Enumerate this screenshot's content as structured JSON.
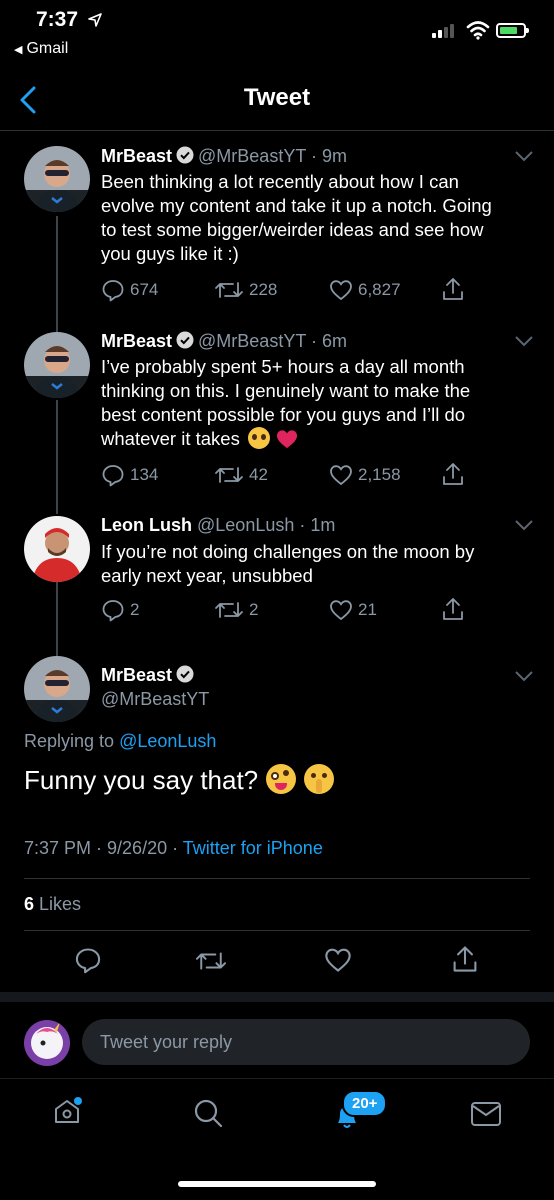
{
  "status_bar": {
    "time": "7:37",
    "back_app": "Gmail"
  },
  "header": {
    "title": "Tweet"
  },
  "tweets": [
    {
      "name": "MrBeast",
      "meta": "@MrBeastYT · 9m",
      "lines": [
        "Been thinking a lot recently about how I can",
        "evolve my content and take it up a notch. Going",
        "to test some bigger/weirder ideas and see how",
        "you guys like it :)"
      ],
      "replies": "674",
      "retweets": "228",
      "likes": "6,827"
    },
    {
      "name": "MrBeast",
      "meta": "@MrBeastYT · 6m",
      "lines": [
        "I’ve probably spent 5+ hours a day all month",
        "thinking on this. I genuinely want to make the",
        "best content possible for you guys and I’ll do",
        "whatever it takes"
      ],
      "replies": "134",
      "retweets": "42",
      "likes": "2,158"
    },
    {
      "name": "Leon Lush",
      "meta": "@LeonLush · 1m",
      "lines": [
        "If you’re not doing challenges on the moon by",
        "early next year, unsubbed"
      ],
      "replies": "2",
      "retweets": "2",
      "likes": "21"
    }
  ],
  "focused": {
    "name": "MrBeast",
    "handle": "@MrBeastYT",
    "replying_prefix": "Replying to ",
    "replying_to": "@LeonLush",
    "text": "Funny you say that?",
    "time": "7:37 PM · 9/26/20 · ",
    "source": "Twitter for iPhone",
    "likes_count": "6",
    "likes_label": "Likes"
  },
  "reply": {
    "placeholder": "Tweet your reply"
  },
  "tab_bar": {
    "notifications_badge": "20+"
  },
  "colors": {
    "accent": "#1da1f2",
    "background": "#000000",
    "muted": "#8b98a5",
    "like_heart": "#e0245e"
  },
  "icons": [
    "location-arrow-icon",
    "back-chevron-icon",
    "verified-icon",
    "caret-down-icon",
    "reply-icon",
    "retweet-icon",
    "like-icon",
    "share-icon",
    "home-icon",
    "search-icon",
    "notifications-icon",
    "messages-icon"
  ]
}
